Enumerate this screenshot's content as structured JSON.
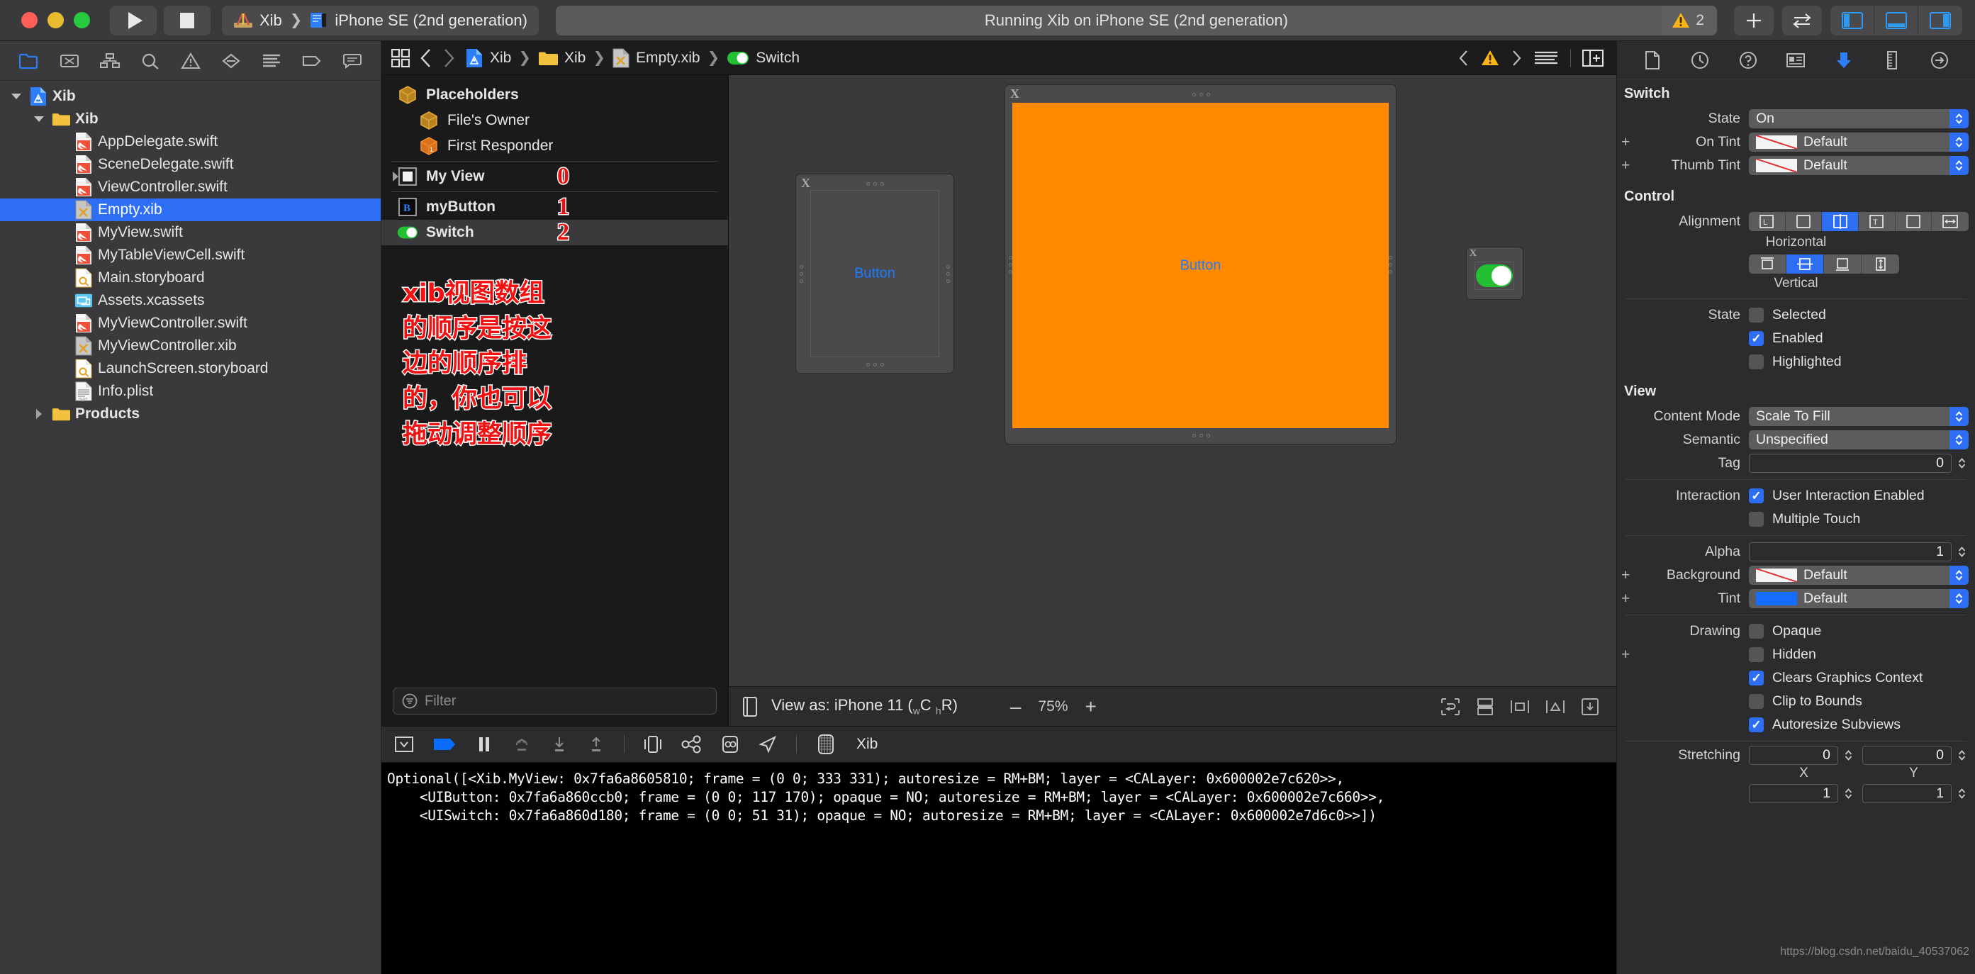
{
  "titlebar": {
    "run_label": "run-button",
    "stop_label": "stop-button",
    "scheme_project": "Xib",
    "scheme_device": "iPhone SE (2nd generation)",
    "status_text": "Running Xib on iPhone SE (2nd generation)",
    "warning_count": "2"
  },
  "navigator": {
    "items": [
      {
        "label": "Xib",
        "icon": "app-project-icon",
        "depth": 0,
        "disclosure": "down",
        "bold": true,
        "selected": false
      },
      {
        "label": "Xib",
        "icon": "folder-icon",
        "depth": 1,
        "disclosure": "down",
        "bold": true,
        "selected": false
      },
      {
        "label": "AppDelegate.swift",
        "icon": "swift-file-icon",
        "depth": 2,
        "disclosure": "",
        "bold": false,
        "selected": false
      },
      {
        "label": "SceneDelegate.swift",
        "icon": "swift-file-icon",
        "depth": 2,
        "disclosure": "",
        "bold": false,
        "selected": false
      },
      {
        "label": "ViewController.swift",
        "icon": "swift-file-icon",
        "depth": 2,
        "disclosure": "",
        "bold": false,
        "selected": false
      },
      {
        "label": "Empty.xib",
        "icon": "xib-file-icon",
        "depth": 2,
        "disclosure": "",
        "bold": false,
        "selected": true
      },
      {
        "label": "MyView.swift",
        "icon": "swift-file-icon",
        "depth": 2,
        "disclosure": "",
        "bold": false,
        "selected": false
      },
      {
        "label": "MyTableViewCell.swift",
        "icon": "swift-file-icon",
        "depth": 2,
        "disclosure": "",
        "bold": false,
        "selected": false
      },
      {
        "label": "Main.storyboard",
        "icon": "storyboard-file-icon",
        "depth": 2,
        "disclosure": "",
        "bold": false,
        "selected": false
      },
      {
        "label": "Assets.xcassets",
        "icon": "assets-catalog-icon",
        "depth": 2,
        "disclosure": "",
        "bold": false,
        "selected": false
      },
      {
        "label": "MyViewController.swift",
        "icon": "swift-file-icon",
        "depth": 2,
        "disclosure": "",
        "bold": false,
        "selected": false
      },
      {
        "label": "MyViewController.xib",
        "icon": "xib-file-icon",
        "depth": 2,
        "disclosure": "",
        "bold": false,
        "selected": false
      },
      {
        "label": "LaunchScreen.storyboard",
        "icon": "storyboard-file-icon",
        "depth": 2,
        "disclosure": "",
        "bold": false,
        "selected": false
      },
      {
        "label": "Info.plist",
        "icon": "plist-file-icon",
        "depth": 2,
        "disclosure": "",
        "bold": false,
        "selected": false
      },
      {
        "label": "Products",
        "icon": "folder-icon",
        "depth": 1,
        "disclosure": "right",
        "bold": true,
        "selected": false
      }
    ]
  },
  "editor": {
    "breadcrumb": [
      {
        "label": "Xib",
        "icon": "app-project-icon"
      },
      {
        "label": "Xib",
        "icon": "folder-icon"
      },
      {
        "label": "Empty.xib",
        "icon": "xib-file-icon"
      },
      {
        "label": "Switch",
        "icon": "switch-on-icon"
      }
    ]
  },
  "outline": {
    "rows": [
      {
        "label": "Placeholders",
        "icon": "cube-icon",
        "indent": 0,
        "bold": true,
        "highlight": false,
        "num": ""
      },
      {
        "label": "File's Owner",
        "icon": "cube-icon",
        "indent": 1,
        "bold": false,
        "highlight": false,
        "num": ""
      },
      {
        "label": "First Responder",
        "icon": "first-responder-icon",
        "indent": 1,
        "bold": false,
        "highlight": false,
        "num": ""
      },
      {
        "label": "My View",
        "icon": "view-square-icon",
        "indent": 0,
        "bold": true,
        "highlight": false,
        "num": "0",
        "disclosure": "right"
      },
      {
        "label": "myButton",
        "icon": "button-b-icon",
        "indent": 0,
        "bold": true,
        "highlight": false,
        "num": "1"
      },
      {
        "label": "Switch",
        "icon": "switch-on-icon",
        "indent": 0,
        "bold": true,
        "highlight": true,
        "num": "2"
      }
    ],
    "annotation_lines": [
      "xib视图数组",
      "的顺序是按这",
      "边的顺序排",
      "的，你也可以",
      "拖动调整顺序"
    ],
    "filter_placeholder": "Filter"
  },
  "canvas": {
    "button_label_small": "Button",
    "button_label_large": "Button",
    "orange_color": "#FF8A00",
    "switch_on_color": "#22C032"
  },
  "canvas_bar": {
    "view_as_prefix": "View as: iPhone 11 (",
    "w_sub": "w",
    "w_class": "C",
    "h_sub": "h",
    "h_class": "R",
    "view_as_suffix": ")",
    "minus": "–",
    "zoom": "75%",
    "plus": "+"
  },
  "debug": {
    "scheme_name": "Xib",
    "console_text": "Optional([<Xib.MyView: 0x7fa6a8605810; frame = (0 0; 333 331); autoresize = RM+BM; layer = <CALayer: 0x600002e7c620>>,\n    <UIButton: 0x7fa6a860ccb0; frame = (0 0; 117 170); opaque = NO; autoresize = RM+BM; layer = <CALayer: 0x600002e7c660>>,\n    <UISwitch: 0x7fa6a860d180; frame = (0 0; 51 31); opaque = NO; autoresize = RM+BM; layer = <CALayer: 0x600002e7d6c0>>])"
  },
  "inspector": {
    "switch_section": {
      "title": "Switch",
      "state_label": "State",
      "state_value": "On",
      "on_tint_label": "On Tint",
      "on_tint_value": "Default",
      "thumb_tint_label": "Thumb Tint",
      "thumb_tint_value": "Default"
    },
    "control_section": {
      "title": "Control",
      "alignment_label": "Alignment",
      "horizontal_sublabel": "Horizontal",
      "vertical_sublabel": "Vertical",
      "horizontal_selected_index": 2,
      "vertical_selected_index": 1,
      "state_label": "State",
      "checks": [
        {
          "label": "Selected",
          "checked": false
        },
        {
          "label": "Enabled",
          "checked": true
        },
        {
          "label": "Highlighted",
          "checked": false
        }
      ]
    },
    "view_section": {
      "title": "View",
      "content_mode_label": "Content Mode",
      "content_mode_value": "Scale To Fill",
      "semantic_label": "Semantic",
      "semantic_value": "Unspecified",
      "tag_label": "Tag",
      "tag_value": "0",
      "interaction_label": "Interaction",
      "interaction_checks": [
        {
          "label": "User Interaction Enabled",
          "checked": true
        },
        {
          "label": "Multiple Touch",
          "checked": false
        }
      ],
      "alpha_label": "Alpha",
      "alpha_value": "1",
      "background_label": "Background",
      "background_value": "Default",
      "tint_label": "Tint",
      "tint_value": "Default",
      "drawing_label": "Drawing",
      "drawing_checks": [
        {
          "label": "Opaque",
          "checked": false
        },
        {
          "label": "Hidden",
          "checked": false
        },
        {
          "label": "Clears Graphics Context",
          "checked": true
        },
        {
          "label": "Clip to Bounds",
          "checked": false
        },
        {
          "label": "Autoresize Subviews",
          "checked": true
        }
      ],
      "stretching_label": "Stretching",
      "stretch_x": "0",
      "stretch_y": "0",
      "stretch_x_sub": "X",
      "stretch_y_sub": "Y",
      "stretch_w": "1",
      "stretch_h": "1"
    }
  },
  "watermark": "https://blog.csdn.net/baidu_40537062",
  "colors": {
    "accent_blue": "#2D6EF5",
    "selection_blue": "#2D6EF5",
    "warning_yellow": "#FDB515",
    "orange_fill": "#FF8A00",
    "annotation_red": "#F21010",
    "switch_green": "#22C032"
  }
}
